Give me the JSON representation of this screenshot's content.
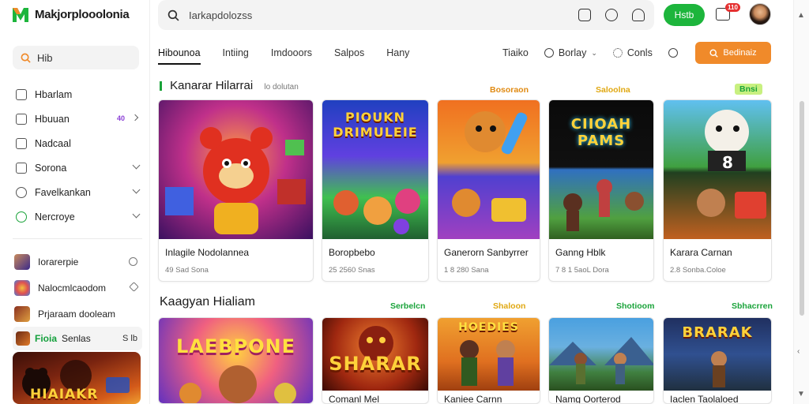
{
  "app": {
    "logo_text": "Makjorplooolonia",
    "accent": "#1db53c",
    "accent_orange": "#f08a2a"
  },
  "sidebar": {
    "search_label": "Hib",
    "items": [
      {
        "label": "Hbarlam",
        "icon": "gift-icon"
      },
      {
        "label": "Hbuuan",
        "icon": "monitor-icon",
        "badge": "40"
      },
      {
        "label": "Nadcaal",
        "icon": "list-icon"
      },
      {
        "label": "Sorona",
        "icon": "square-icon"
      },
      {
        "label": "Favelkankan",
        "icon": "clock-icon"
      },
      {
        "label": "Nercroye",
        "icon": "power-icon"
      }
    ],
    "friends": [
      {
        "label": "Iorarerpie"
      },
      {
        "label": "Nalocmlcaodom"
      },
      {
        "label": "Prjaraam dooleam"
      }
    ],
    "promo": {
      "green_label": "Fioia",
      "label": "Senlas",
      "right": "S lb",
      "card_title": "HIAIAKR"
    }
  },
  "topbar": {
    "search_placeholder": "Iarkapdolozss",
    "green_button": "Hstb",
    "notif_count": "110"
  },
  "tabs": [
    "Hibounoa",
    "Intiing",
    "Imdooors",
    "Salpos",
    "Hany"
  ],
  "tabs_right": [
    "Tiaiko",
    "Borlay",
    "Conls"
  ],
  "orange_button": "Bedinaiz",
  "section1": {
    "title": "Kanarar Hilarrai",
    "sub": "lo dolutan",
    "tags": [
      {
        "text": "Bosoraon",
        "color": "#e08a12"
      },
      {
        "text": "Saloolna",
        "color": "#e0a812"
      },
      {
        "text": "Bnsi",
        "color": "#1aa33a"
      }
    ],
    "cards": [
      {
        "name": "Inlagile Nodolannea",
        "meta": "49 Sad Sona",
        "art": ""
      },
      {
        "name": "Boropbebo",
        "meta": "25 2560 Snas",
        "art": "PIOUKN DRIMULEIE"
      },
      {
        "name": "Ganerorn Sanbyrrer",
        "meta": "1 8 280 Sana",
        "art": ""
      },
      {
        "name": "Ganng Hblk",
        "meta": "7 8 1 5aoL Dora",
        "art": "CIIOAH PAMS"
      },
      {
        "name": "Karara Carnan",
        "meta": "2.8 Sonba.Coloe",
        "art": ""
      }
    ]
  },
  "section2": {
    "title": "Kaagyan Hialiam",
    "tags": [
      {
        "text": "Serbelcn",
        "color": "#1aa33a"
      },
      {
        "text": "Shaloon",
        "color": "#e0a812"
      },
      {
        "text": "Shotioom",
        "color": "#1aa33a"
      },
      {
        "text": "Sbhacrren",
        "color": "#1aa33a"
      }
    ],
    "cards": [
      {
        "name": "",
        "art": "LAEBPONE"
      },
      {
        "name": "Comanl Mel",
        "art": "SHARAR"
      },
      {
        "name": "Kaniee Carnn",
        "art": "HOEDIES"
      },
      {
        "name": "Namg Oorterod",
        "art": ""
      },
      {
        "name": "Iaclen Taolaloed",
        "art": "BRARAK"
      }
    ]
  }
}
